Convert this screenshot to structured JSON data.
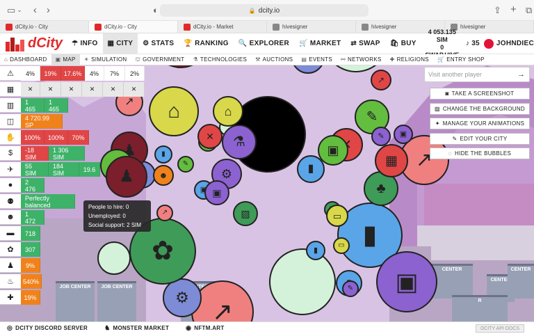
{
  "browser": {
    "url": "dcity.io",
    "tabs": [
      {
        "label": "dCity.io - City",
        "color": "#e02a2a",
        "active": false
      },
      {
        "label": "dCity.io - City",
        "color": "#e02a2a",
        "active": true
      },
      {
        "label": "dCity.io - Market",
        "color": "#e02a2a",
        "active": false
      },
      {
        "label": "hivesigner",
        "color": "#888888",
        "active": false
      },
      {
        "label": "hivesigner",
        "color": "#888888",
        "active": false
      },
      {
        "label": "hivesigner",
        "color": "#888888",
        "active": false
      }
    ]
  },
  "nav": {
    "logo": "dCity",
    "items": [
      {
        "label": "INFO",
        "icon": "info-icon",
        "glyph": "☂",
        "active": false
      },
      {
        "label": "CITY",
        "icon": "city-icon",
        "glyph": "▦",
        "active": true
      },
      {
        "label": "STATS",
        "icon": "stats-icon",
        "glyph": "⚙",
        "active": false
      },
      {
        "label": "RANKING",
        "icon": "trophy-icon",
        "glyph": "🏆",
        "active": false
      },
      {
        "label": "EXPLORER",
        "icon": "search-icon",
        "glyph": "🔍",
        "active": false
      },
      {
        "label": "MARKET",
        "icon": "cart-icon",
        "glyph": "🛒",
        "active": false
      },
      {
        "label": "SWAP",
        "icon": "swap-icon",
        "glyph": "⇄",
        "active": false
      },
      {
        "label": "BUY",
        "icon": "bag-icon",
        "glyph": "🛍",
        "active": false
      }
    ],
    "wallet_sim": "4 053.135 SIM",
    "wallet_swap": "0 SWAP.HIVE",
    "notifications": "35",
    "user": "JOHNDIEC"
  },
  "subnav": [
    {
      "label": "DASHBOARD",
      "icon": "dashboard-icon",
      "glyph": "⌂",
      "active": false
    },
    {
      "label": "MAP",
      "icon": "map-icon",
      "glyph": "▣",
      "active": true
    },
    {
      "label": "SIMULATION",
      "icon": "simulation-icon",
      "glyph": "☀",
      "active": false
    },
    {
      "label": "GOVERNMENT",
      "icon": "government-icon",
      "glyph": "⛫",
      "active": false
    },
    {
      "label": "TECHNOLOGIES",
      "icon": "tech-icon",
      "glyph": "⚗",
      "active": false
    },
    {
      "label": "AUCTIONS",
      "icon": "auction-icon",
      "glyph": "⚒",
      "active": false
    },
    {
      "label": "EVENTS",
      "icon": "events-icon",
      "glyph": "▤",
      "active": false
    },
    {
      "label": "NETWORKS",
      "icon": "network-icon",
      "glyph": "⚯",
      "active": false
    },
    {
      "label": "RELIGIONS",
      "icon": "religion-icon",
      "glyph": "✚",
      "active": false
    },
    {
      "label": "ENTRY SHOP",
      "icon": "shop-icon",
      "glyph": "🛒",
      "active": false
    }
  ],
  "stats": [
    {
      "icon": "warning-icon",
      "glyph": "⚠",
      "cells": [
        {
          "v": "4%",
          "c": "white",
          "w": 28
        },
        {
          "v": "19%",
          "c": "red",
          "w": 30
        },
        {
          "v": "17.6%",
          "c": "red",
          "w": 34
        },
        {
          "v": "4%",
          "c": "white",
          "w": 28
        },
        {
          "v": "7%",
          "c": "white",
          "w": 30
        },
        {
          "v": "2%",
          "c": "white",
          "w": 28
        }
      ]
    },
    {
      "icon": "calendar-icon",
      "glyph": "▦",
      "cells": [
        {
          "v": "✕",
          "c": "gray",
          "w": 28
        },
        {
          "v": "✕",
          "c": "gray",
          "w": 30
        },
        {
          "v": "✕",
          "c": "gray",
          "w": 30
        },
        {
          "v": "✕",
          "c": "gray",
          "w": 30
        },
        {
          "v": "✕",
          "c": "gray",
          "w": 30
        },
        {
          "v": "✕",
          "c": "gray",
          "w": 30
        }
      ]
    },
    {
      "icon": "building-icon",
      "glyph": "▥",
      "cells": [
        {
          "v": "1 465",
          "c": "green",
          "w": 34
        },
        {
          "v": "1 465",
          "c": "green",
          "w": 34
        }
      ]
    },
    {
      "icon": "coins-icon",
      "glyph": "◫",
      "cells": [
        {
          "v": "4 720.99 SP",
          "c": "orange",
          "w": 60
        }
      ]
    },
    {
      "icon": "hand-icon",
      "glyph": "✋",
      "cells": [
        {
          "v": "100%",
          "c": "red",
          "w": 34
        },
        {
          "v": "100%",
          "c": "red",
          "w": 34
        },
        {
          "v": "70%",
          "c": "red",
          "w": 30
        }
      ]
    },
    {
      "icon": "dollar-icon",
      "glyph": "$",
      "cells": [
        {
          "v": "-18 SIM",
          "c": "red",
          "w": 40
        },
        {
          "v": "1 306 SIM",
          "c": "green",
          "w": 52
        }
      ]
    },
    {
      "icon": "plane-icon",
      "glyph": "✈",
      "cells": [
        {
          "v": "55 SIM",
          "c": "green",
          "w": 40
        },
        {
          "v": "184 SIM",
          "c": "green",
          "w": 44
        },
        {
          "v": "19.6",
          "c": "green",
          "w": 30
        }
      ]
    },
    {
      "icon": "user-icon",
      "glyph": "●",
      "cells": [
        {
          "v": "2 476",
          "c": "green",
          "w": 34
        }
      ]
    },
    {
      "icon": "users-icon",
      "glyph": "⚉",
      "cells": [
        {
          "v": "Perfectly balanced",
          "c": "green",
          "w": 78
        }
      ]
    },
    {
      "icon": "happiness-icon",
      "glyph": "☻",
      "cells": [
        {
          "v": "1 472",
          "c": "green",
          "w": 34
        }
      ]
    },
    {
      "icon": "education-icon",
      "glyph": "▬",
      "cells": [
        {
          "v": "718",
          "c": "green",
          "w": 28
        }
      ]
    },
    {
      "icon": "palette-icon",
      "glyph": "✿",
      "cells": [
        {
          "v": "307",
          "c": "green",
          "w": 28
        }
      ]
    },
    {
      "icon": "thief-icon",
      "glyph": "♟",
      "cells": [
        {
          "v": "9%",
          "c": "orange",
          "w": 28
        }
      ]
    },
    {
      "icon": "pollution-icon",
      "glyph": "♨",
      "cells": [
        {
          "v": "540%",
          "c": "orange",
          "w": 30
        }
      ]
    },
    {
      "icon": "health-icon",
      "glyph": "✚",
      "cells": [
        {
          "v": "19%",
          "c": "orange",
          "w": 28
        }
      ]
    }
  ],
  "tooltip": {
    "line1": "People to hire: 0",
    "line2": "Unemployed: 0",
    "line3": "Social support: 2 SIM"
  },
  "right_panel": {
    "visit_placeholder": "Visit another player",
    "buttons": [
      {
        "label": "TAKE A SCREENSHOT",
        "icon": "camera-icon",
        "glyph": "◙"
      },
      {
        "label": "CHANGE THE BACKGROUND",
        "icon": "image-icon",
        "glyph": "▨"
      },
      {
        "label": "MANAGE YOUR ANIMATIONS",
        "icon": "wand-icon",
        "glyph": "✦"
      },
      {
        "label": "EDIT YOUR CITY",
        "icon": "edit-icon",
        "glyph": "✎"
      },
      {
        "label": "HIDE THE BUBBLES",
        "icon": "eye-slash-icon",
        "glyph": "◌"
      }
    ]
  },
  "city_labels": [
    "JOB CENTER",
    "JOB CENTER",
    "CENTER",
    "CENTER",
    "CENTER",
    "CENTER",
    "R"
  ],
  "bubbles": [
    {
      "c": "#7a1f2b",
      "g": "♟",
      "fg": "#222"
    },
    {
      "c": "#d4f2d9",
      "g": "",
      "fg": "#222"
    },
    {
      "c": "#3f9b58",
      "g": "✆",
      "fg": "#222"
    },
    {
      "c": "#8c62d0",
      "g": "✈",
      "fg": "#222"
    },
    {
      "c": "#63bd3e",
      "g": "▭",
      "fg": "#222"
    },
    {
      "c": "#59a5e8",
      "g": "▮",
      "fg": "#222"
    },
    {
      "c": "#d4f2d9",
      "g": "",
      "fg": "#222"
    },
    {
      "c": "#8c62d0",
      "g": "✉",
      "fg": "#222"
    },
    {
      "c": "#f08080",
      "g": "✎",
      "fg": "#222"
    },
    {
      "c": "#e04646",
      "g": "✕",
      "fg": "#222"
    },
    {
      "c": "#7a1f2b",
      "g": "⌂",
      "fg": "#222"
    },
    {
      "c": "#7e8bd6",
      "g": "⚙",
      "fg": "#222"
    },
    {
      "c": "#8c62d0",
      "g": "▣",
      "fg": "#222"
    },
    {
      "c": "#000000",
      "g": "",
      "fg": "#222"
    },
    {
      "c": "#d8d84a",
      "g": "⌂",
      "fg": "#222"
    },
    {
      "c": "#f08080",
      "g": "↗",
      "fg": "#222"
    },
    {
      "c": "#e04646",
      "g": "↗",
      "fg": "#222"
    },
    {
      "c": "#59a5e8",
      "g": "▮",
      "fg": "#222"
    },
    {
      "c": "#d4f2d9",
      "g": "",
      "fg": "#222"
    },
    {
      "c": "#f08080",
      "g": "↗",
      "fg": "#222"
    },
    {
      "c": "#8c62d0",
      "g": "▣",
      "fg": "#222"
    },
    {
      "c": "#63bd3e",
      "g": "✎",
      "fg": "#222"
    },
    {
      "c": "#3f9b58",
      "g": "▦",
      "fg": "#222"
    },
    {
      "c": "#d8d84a",
      "g": "▭",
      "fg": "#222"
    },
    {
      "c": "#59a5e8",
      "g": "▮",
      "fg": "#222"
    },
    {
      "c": "#3f9b58",
      "g": "♣",
      "fg": "#222"
    },
    {
      "c": "#e04646",
      "g": "▦",
      "fg": "#222"
    },
    {
      "c": "#8c62d0",
      "g": "✎",
      "fg": "#222"
    },
    {
      "c": "#e04646",
      "g": "↗",
      "fg": "#222"
    },
    {
      "c": "#8c62d0",
      "g": "▣",
      "fg": "#222"
    },
    {
      "c": "#f08080",
      "g": "↗",
      "fg": "#222"
    },
    {
      "c": "#7e8bd6",
      "g": "♪",
      "fg": "#222"
    },
    {
      "c": "#7a1f2b",
      "g": "♟",
      "fg": "#222"
    },
    {
      "c": "#63bd3e",
      "g": "✎",
      "fg": "#222"
    },
    {
      "c": "#8c62d0",
      "g": "⚙",
      "fg": "#222"
    },
    {
      "c": "#59a5e8",
      "g": "▣",
      "fg": "#222"
    },
    {
      "c": "#3f9b58",
      "g": "▨",
      "fg": "#222"
    },
    {
      "c": "#63bd3e",
      "g": "✎",
      "fg": "#222"
    },
    {
      "c": "#d4f2d9",
      "g": "",
      "fg": "#222"
    },
    {
      "c": "#e04646",
      "g": "✕",
      "fg": "#222"
    },
    {
      "c": "#7e8bd6",
      "g": "⚙",
      "fg": "#222"
    },
    {
      "c": "#59a5e8",
      "g": "▮",
      "fg": "#222"
    },
    {
      "c": "#d8d84a",
      "g": "⌂",
      "fg": "#222"
    },
    {
      "c": "#8c62d0",
      "g": "▣",
      "fg": "#222"
    },
    {
      "c": "#63bd3e",
      "g": "✎",
      "fg": "#222"
    },
    {
      "c": "#f0821c",
      "g": "☻",
      "fg": "#222"
    },
    {
      "c": "#59a5e8",
      "g": "▮",
      "fg": "#222"
    },
    {
      "c": "#3f9b58",
      "g": "✿",
      "fg": "#222"
    },
    {
      "c": "#d4f2d9",
      "g": "",
      "fg": "#222"
    },
    {
      "c": "#7a1f2b",
      "g": "♟",
      "fg": "#222"
    },
    {
      "c": "#8c62d0",
      "g": "⚗",
      "fg": "#222"
    },
    {
      "c": "#e04646",
      "g": "✕",
      "fg": "#222"
    },
    {
      "c": "#63bd3e",
      "g": "▣",
      "fg": "#222"
    },
    {
      "c": "#59a5e8",
      "g": "▮",
      "fg": "#222"
    },
    {
      "c": "#d8d84a",
      "g": "▭",
      "fg": "#222"
    },
    {
      "c": "#f08080",
      "g": "↗",
      "fg": "#222"
    },
    {
      "c": "#8c62d0",
      "g": "✎",
      "fg": "#222"
    }
  ],
  "footer": {
    "items": [
      {
        "label": "DCITY DISCORD SERVER",
        "icon": "discord-icon",
        "glyph": "◎"
      },
      {
        "label": "MONSTER MARKET",
        "icon": "monster-icon",
        "glyph": "♞"
      },
      {
        "label": "NFTM.ART",
        "icon": "nftm-icon",
        "glyph": "◉"
      }
    ],
    "api": "DCITY API DOCS"
  }
}
